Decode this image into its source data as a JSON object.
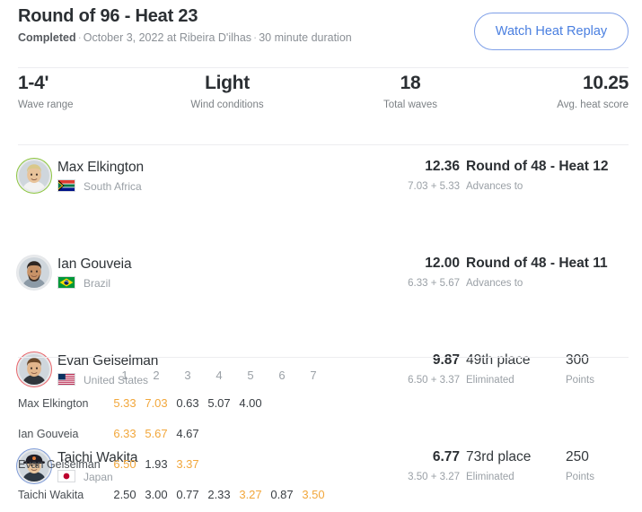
{
  "header": {
    "title": "Round of 96 - Heat 23",
    "status": "Completed",
    "date": "October 3, 2022",
    "location_prefix": "at",
    "location": "Ribeira D'ilhas",
    "duration": "30 minute duration",
    "sep": "·",
    "replay_button": "Watch Heat Replay",
    "accent_blue": "#4a7fe0"
  },
  "stats": [
    {
      "value": "1-4'",
      "label": "Wave range"
    },
    {
      "value": "Light",
      "label": "Wind conditions"
    },
    {
      "value": "18",
      "label": "Total waves"
    },
    {
      "value": "10.25",
      "label": "Avg. heat score"
    }
  ],
  "athletes": [
    {
      "name": "Max Elkington",
      "country": "South Africa",
      "flag": "za-flag-icon",
      "score": "12.36",
      "waves": "7.03 + 5.33",
      "result": "Round of 48 - Heat 12",
      "status": "Advances to",
      "points": "",
      "points_label": "",
      "ring_color": "#8dc63f"
    },
    {
      "name": "Ian Gouveia",
      "country": "Brazil",
      "flag": "br-flag-icon",
      "score": "12.00",
      "waves": "6.33 + 5.67",
      "result": "Round of 48 - Heat 11",
      "status": "Advances to",
      "points": "",
      "points_label": "",
      "ring_color": "#e4e6e9"
    },
    {
      "name": "Evan Geiselman",
      "country": "United States",
      "flag": "us-flag-icon",
      "score": "9.87",
      "waves": "6.50 + 3.37",
      "result": "49th place",
      "status": "Eliminated",
      "points": "300",
      "points_label": "Points",
      "ring_color": "#e8656b"
    },
    {
      "name": "Taichi Wakita",
      "country": "Japan",
      "flag": "jp-flag-icon",
      "score": "6.77",
      "waves": "3.50 + 3.27",
      "result": "73rd place",
      "status": "Eliminated",
      "points": "250",
      "points_label": "Points",
      "ring_color": "#7f9cd8"
    }
  ],
  "wave_table": {
    "columns": [
      "1",
      "2",
      "3",
      "4",
      "5",
      "6",
      "7"
    ],
    "counting_color": "#f2a73b",
    "rows": [
      {
        "name": "Max Elkington",
        "scores": [
          {
            "value": "5.33",
            "counting": true
          },
          {
            "value": "7.03",
            "counting": true
          },
          {
            "value": "0.63",
            "counting": false
          },
          {
            "value": "5.07",
            "counting": false
          },
          {
            "value": "4.00",
            "counting": false
          }
        ]
      },
      {
        "name": "Ian Gouveia",
        "scores": [
          {
            "value": "6.33",
            "counting": true
          },
          {
            "value": "5.67",
            "counting": true
          },
          {
            "value": "4.67",
            "counting": false
          }
        ]
      },
      {
        "name": "Evan Geiselman",
        "scores": [
          {
            "value": "6.50",
            "counting": true
          },
          {
            "value": "1.93",
            "counting": false
          },
          {
            "value": "3.37",
            "counting": true
          }
        ]
      },
      {
        "name": "Taichi Wakita",
        "scores": [
          {
            "value": "2.50",
            "counting": false
          },
          {
            "value": "3.00",
            "counting": false
          },
          {
            "value": "0.77",
            "counting": false
          },
          {
            "value": "2.33",
            "counting": false
          },
          {
            "value": "3.27",
            "counting": true
          },
          {
            "value": "0.87",
            "counting": false
          },
          {
            "value": "3.50",
            "counting": true
          }
        ]
      }
    ]
  }
}
